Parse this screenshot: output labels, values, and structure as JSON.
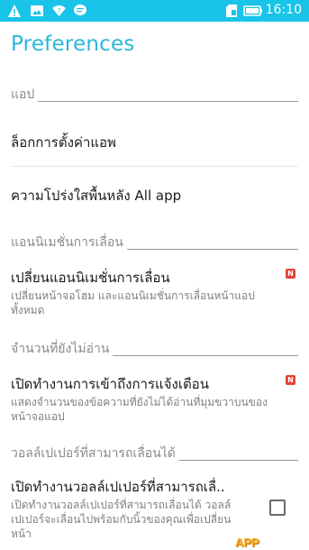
{
  "status_bar": {
    "time": "16:10",
    "colors": {
      "background": "#18c4e8"
    },
    "icons_left": [
      "warning-icon",
      "image-notification-icon",
      "wifi-question-icon",
      "chat-icon"
    ],
    "icons_right": [
      "sd-card-icon",
      "battery-icon"
    ]
  },
  "title": "Preferences",
  "sections": [
    {
      "header": "แอป",
      "items": [
        {
          "title": "ล็อกการตั้งค่าแอพ"
        },
        {
          "title": "ความโปร่งใสพื้นหลัง All app"
        }
      ]
    },
    {
      "header": "แอนนิเมชั่นการเลื่อน",
      "items": [
        {
          "title": "เปลี่ยนแอนนิเมชั่นการเลื่อน",
          "subtitle_line1": "เปลี่ยนหน้าจอโฮม และแอนนิเมชั่นการเลื่อนหน้าแอป",
          "subtitle_line2": "ทั้งหมด",
          "badge": "N"
        }
      ]
    },
    {
      "header": "จำนวนที่ยังไม่อ่าน",
      "items": [
        {
          "title": "เปิดทำงานการเข้าถึงการแจ้งเตือน",
          "subtitle_line1": "แสดงจำนวนของข้อความที่ยังไม่ได้อ่านที่มุมขวาบนของ",
          "subtitle_line2": "หน้าจอแอป",
          "badge": "N"
        }
      ]
    },
    {
      "header": "วอลล์เปเปอร์ที่สามารถเลื่อนได้",
      "items": [
        {
          "title": "เปิดทำงานวอลล์เปเปอร์ที่สามารถเลื่..",
          "subtitle_line1": "เปิดทำงานวอลล์เปเปอร์ที่สามารถเลื่อนได้ วอลล์",
          "subtitle_line2": "เปเปอร์จะเลื่อนไปพร้อมกับนิ้วของคุณเพื่อเปลี่ยน",
          "subtitle_line3": "หน้า",
          "checked": false
        }
      ]
    }
  ],
  "watermark_text": "APP"
}
